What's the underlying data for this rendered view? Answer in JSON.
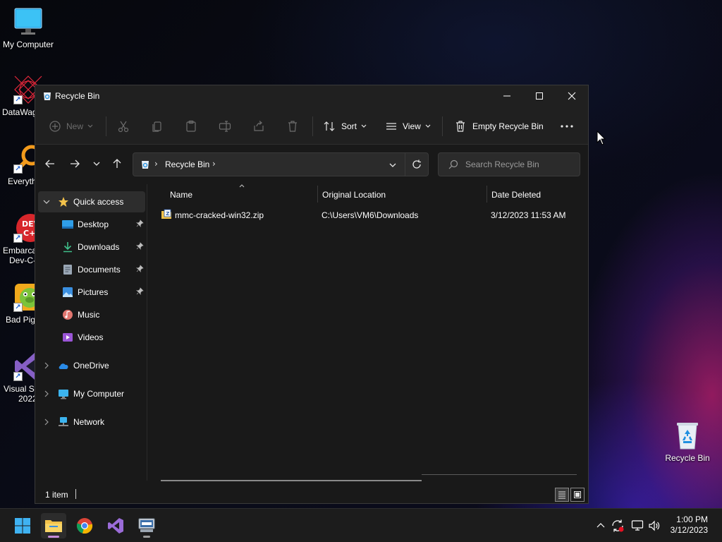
{
  "desktop": {
    "icons": [
      {
        "label": "My Computer"
      },
      {
        "label": "DataWag"
      },
      {
        "label": "Everyth"
      },
      {
        "label": "Embarca",
        "label2": "Dev-C-"
      },
      {
        "label": "Bad Pig"
      },
      {
        "label": "Visual St",
        "label2": "2022"
      },
      {
        "label": "Recycle Bin"
      }
    ]
  },
  "window": {
    "title": "Recycle Bin",
    "toolbar": {
      "new": "New",
      "sort": "Sort",
      "view": "View",
      "empty": "Empty Recycle Bin"
    },
    "address": {
      "path": "Recycle Bin"
    },
    "search": {
      "placeholder": "Search Recycle Bin"
    },
    "sidebar": {
      "quick_access": "Quick access",
      "items": [
        {
          "label": "Desktop"
        },
        {
          "label": "Downloads"
        },
        {
          "label": "Documents"
        },
        {
          "label": "Pictures"
        },
        {
          "label": "Music"
        },
        {
          "label": "Videos"
        }
      ],
      "onedrive": "OneDrive",
      "my_computer": "My Computer",
      "network": "Network"
    },
    "columns": {
      "name": "Name",
      "original_location": "Original Location",
      "date_deleted": "Date Deleted"
    },
    "files": [
      {
        "name": "mmc-cracked-win32.zip",
        "original_location": "C:\\Users\\VM6\\Downloads",
        "date_deleted": "3/12/2023 11:53 AM"
      }
    ],
    "status": {
      "count": "1 item"
    }
  },
  "taskbar": {
    "clock": {
      "time": "1:00 PM",
      "date": "3/12/2023"
    }
  },
  "colors": {
    "accent_folder": "#f3c24a",
    "window_bg": "#191919",
    "taskbar_bg": "#1c1c1c"
  }
}
